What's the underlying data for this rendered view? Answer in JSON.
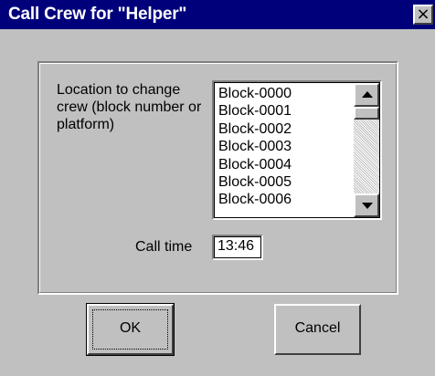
{
  "window": {
    "title": "Call Crew for \"Helper\"",
    "close_glyph": "×"
  },
  "location": {
    "label": "Location to change crew (block number or platform)",
    "items": [
      "Block-0000",
      "Block-0001",
      "Block-0002",
      "Block-0003",
      "Block-0004",
      "Block-0005",
      "Block-0006"
    ]
  },
  "call_time": {
    "label": "Call time",
    "value": "13:46"
  },
  "buttons": {
    "ok": "OK",
    "cancel": "Cancel"
  },
  "colors": {
    "titlebar": "#00007b",
    "face": "#c0c0c0"
  }
}
